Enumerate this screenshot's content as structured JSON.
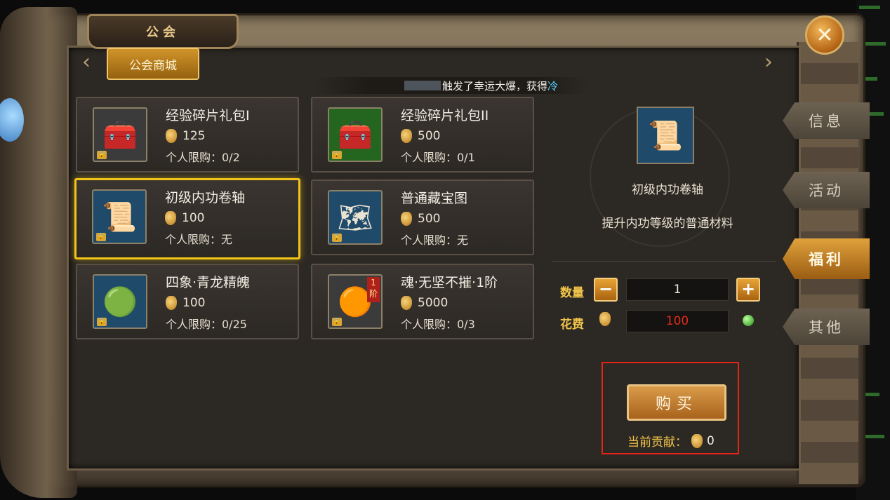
{
  "window": {
    "title": "公会",
    "close_icon": "close-x-icon"
  },
  "shop_tab": {
    "label": "公会商城"
  },
  "ticker": {
    "prefix": "触发了幸运大爆，获得 ",
    "highlight": "冷"
  },
  "items": [
    {
      "name": "经验碎片礼包I",
      "price": "125",
      "limit": "个人限购：0/2",
      "icon": "blue-gold-chest-icon",
      "bg": "#3b3b3b"
    },
    {
      "name": "经验碎片礼包II",
      "price": "500",
      "limit": "个人限购：0/1",
      "icon": "red-gold-chest-icon",
      "bg": "#24651f"
    },
    {
      "name": "初级内功卷轴",
      "price": "100",
      "limit": "个人限购：无",
      "icon": "scroll-icon",
      "bg": "#1f4a6a"
    },
    {
      "name": "普通藏宝图",
      "price": "500",
      "limit": "个人限购：无",
      "icon": "treasure-map-icon",
      "bg": "#1f4a6a"
    },
    {
      "name": "四象·青龙精魄",
      "price": "100",
      "limit": "个人限购：0/25",
      "icon": "green-dragon-orb-icon",
      "bg": "#1f4a6a"
    },
    {
      "name": "魂·无坚不摧·1阶",
      "price": "5000",
      "limit": "个人限购：0/3",
      "icon": "orange-soul-orb-icon",
      "bg": "#3b3b3b",
      "tier": "1 阶"
    }
  ],
  "selected_index": 2,
  "detail": {
    "name": "初级内功卷轴",
    "description": "提升内功等级的普通材料",
    "quantity_label": "数量",
    "quantity": "1",
    "cost_label": "花费",
    "cost": "100",
    "buy_label": "购买",
    "contribution_label": "当前贡献：",
    "contribution": "0"
  },
  "side_tabs": [
    {
      "label": "信息",
      "active": false
    },
    {
      "label": "活动",
      "active": false
    },
    {
      "label": "福利",
      "active": true
    },
    {
      "label": "其他",
      "active": false
    }
  ],
  "colors": {
    "accent": "#f2c318",
    "cost_red": "#e12a1a",
    "label_gold": "#f0c44a"
  }
}
